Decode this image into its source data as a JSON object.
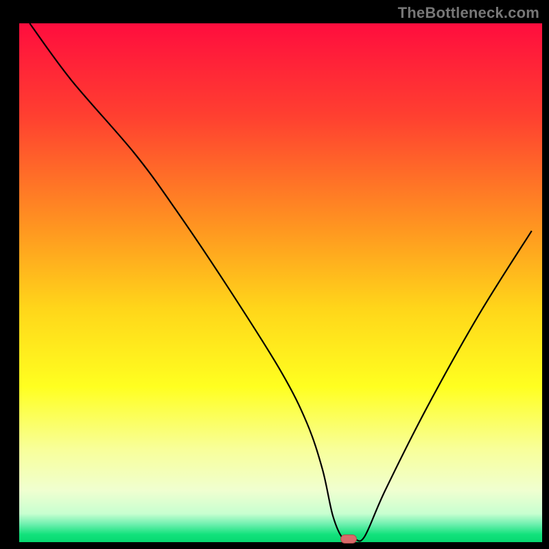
{
  "attribution": "TheBottleneck.com",
  "chart_data": {
    "type": "line",
    "title": "",
    "xlabel": "",
    "ylabel": "",
    "xlim": [
      0,
      100
    ],
    "ylim": [
      0,
      100
    ],
    "legend": false,
    "grid": false,
    "background_gradient_stops": [
      {
        "offset": 0.0,
        "color": "#ff0d3e"
      },
      {
        "offset": 0.18,
        "color": "#ff4030"
      },
      {
        "offset": 0.4,
        "color": "#ff9820"
      },
      {
        "offset": 0.55,
        "color": "#ffd61a"
      },
      {
        "offset": 0.7,
        "color": "#ffff20"
      },
      {
        "offset": 0.82,
        "color": "#f8ff99"
      },
      {
        "offset": 0.9,
        "color": "#f0ffd0"
      },
      {
        "offset": 0.945,
        "color": "#c8ffd0"
      },
      {
        "offset": 0.965,
        "color": "#70f0b0"
      },
      {
        "offset": 0.985,
        "color": "#12e27c"
      },
      {
        "offset": 1.0,
        "color": "#06d870"
      }
    ],
    "series": [
      {
        "name": "bottleneck-curve",
        "stroke": "#000000",
        "stroke_width": 2.2,
        "x": [
          2,
          10,
          22,
          30,
          40,
          50,
          55,
          58,
          60,
          62,
          64,
          66,
          70,
          78,
          88,
          98
        ],
        "y": [
          100,
          89,
          75,
          64,
          49,
          33,
          23,
          14,
          5,
          0.6,
          0.6,
          1.0,
          10,
          26,
          44,
          60
        ]
      }
    ],
    "optimal_marker": {
      "x": 63,
      "y": 0.6,
      "width": 3.0,
      "height": 1.6,
      "fill": "#d96a6a",
      "stroke": "#b24848"
    }
  }
}
